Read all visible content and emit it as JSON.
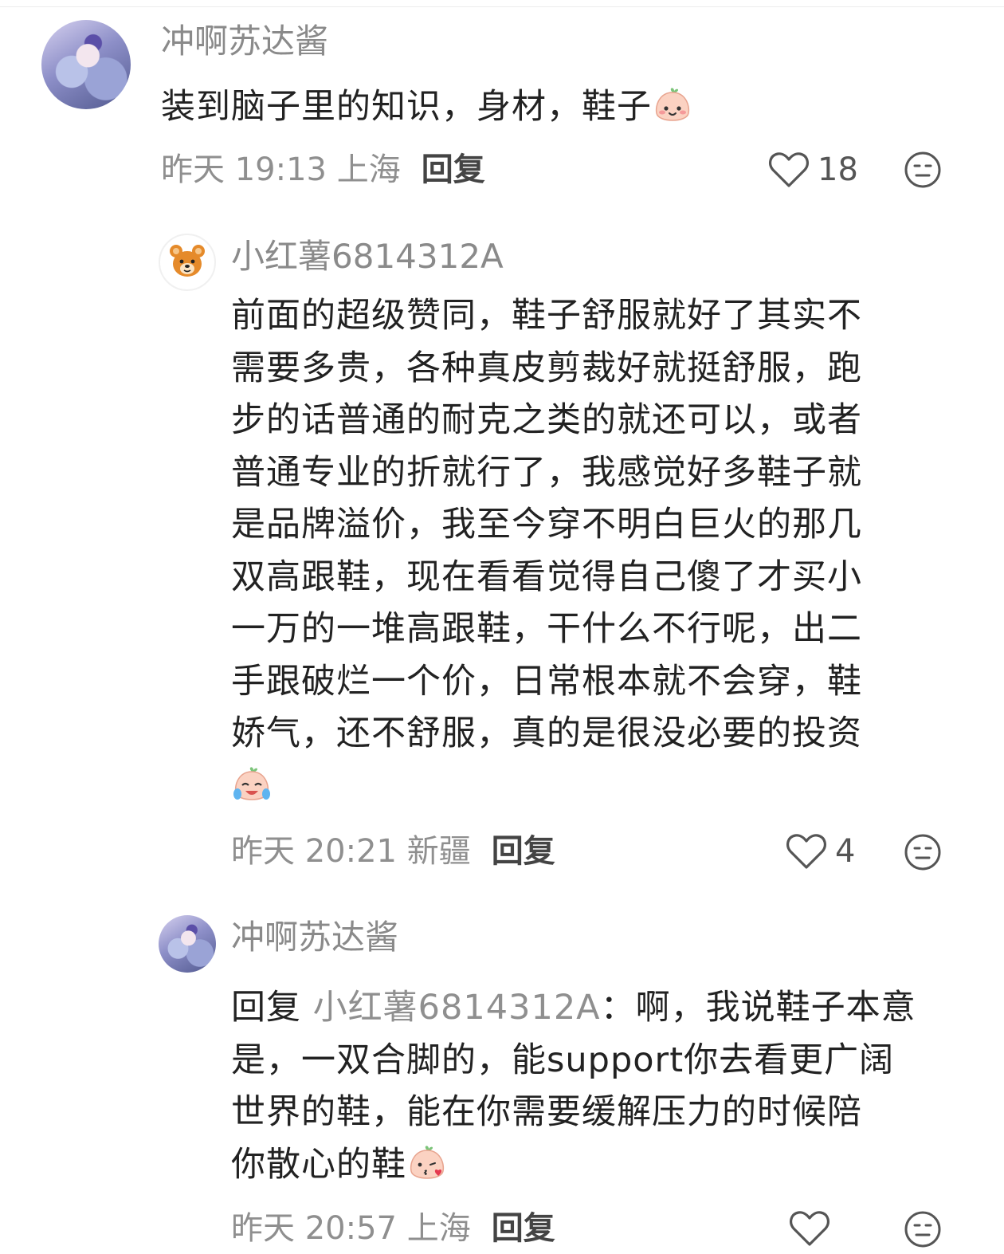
{
  "comments": [
    {
      "username": "冲啊苏达酱",
      "text": "装到脑子里的知识，身材，鞋子",
      "emoji": "smiling-peach-emoji",
      "time": "昨天 19:13 上海",
      "reply_label": "回复",
      "likes": "18"
    },
    {
      "username": "小红薯6814312A",
      "lines": [
        "前面的超级赞同，鞋子舒服就好了其实不",
        "需要多贵，各种真皮剪裁好就挺舒服，跑",
        "步的话普通的耐克之类的就还可以，或者",
        "普通专业的折就行了，我感觉好多鞋子就",
        "是品牌溢价，我至今穿不明白巨火的那几",
        "双高跟鞋，现在看看觉得自己傻了才买小",
        "一万的一堆高跟鞋，干什么不行呢，出二",
        "手跟破烂一个价，日常根本就不会穿，鞋",
        "娇气，还不舒服，真的是很没必要的投资"
      ],
      "emoji": "crying-laughing-peach-emoji",
      "time": "昨天 20:21 新疆",
      "reply_label": "回复",
      "likes": "4"
    },
    {
      "username": "冲啊苏达酱",
      "reply_prefix": "回复",
      "reply_to": "小红薯6814312A",
      "reply_colon": "：",
      "line1_rest": "啊，我说鞋子本意",
      "lines": [
        "是，一双合脚的，能support你去看更广阔",
        "世界的鞋，能在你需要缓解压力的时候陪"
      ],
      "last_line": "你散心的鞋",
      "emoji": "kissing-peach-emoji",
      "time": "昨天 20:57 上海",
      "reply_label": "回复",
      "likes": ""
    }
  ],
  "colors": {
    "text": "#222222",
    "muted": "#8f8f8f",
    "username": "#8a8a8a",
    "reply": "#444444"
  }
}
